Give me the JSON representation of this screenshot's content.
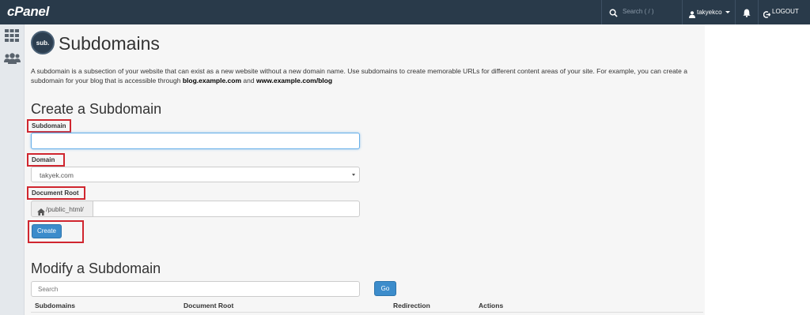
{
  "app": {
    "logo": "cPanel"
  },
  "topbar": {
    "search_placeholder": "Search ( / )",
    "username": "takyekco",
    "logout_label": "LOGOUT"
  },
  "sidebar": {
    "items": [
      {
        "icon": "grid-icon"
      },
      {
        "icon": "users-icon"
      }
    ]
  },
  "page": {
    "badge": "sub.",
    "title": "Subdomains",
    "description_text": "A subdomain is a subsection of your website that can exist as a new website without a new domain name. Use subdomains to create memorable URLs for different content areas of your site. For example, you can create a subdomain for your blog that is accessible through",
    "example_one": "blog.example.com",
    "and_text": "and",
    "example_two": "www.example.com/blog"
  },
  "create": {
    "heading": "Create a Subdomain",
    "subdomain_label": "Subdomain",
    "subdomain_value": "",
    "domain_label": "Domain",
    "domain_selected": "takyek.com",
    "docroot_label": "Document Root",
    "docroot_prefix": "/public_html/",
    "docroot_value": "",
    "create_button": "Create"
  },
  "modify": {
    "heading": "Modify a Subdomain",
    "search_placeholder": "Search",
    "go_button": "Go",
    "columns": [
      "Subdomains",
      "Document Root",
      "Redirection",
      "Actions"
    ]
  },
  "colors": {
    "topbar": "#293a4a",
    "accent": "#3c8ccb",
    "highlight": "#d0262f"
  }
}
